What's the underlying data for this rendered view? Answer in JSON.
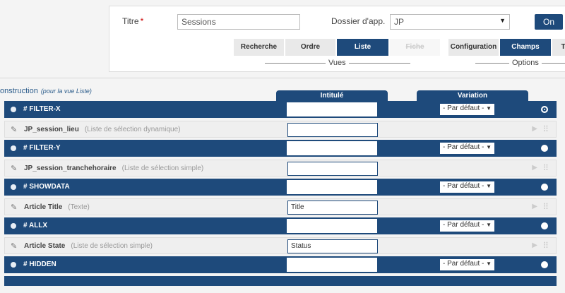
{
  "form": {
    "titre_label": "Titre",
    "required_mark": "*",
    "titre_value": "Sessions",
    "dossier_label": "Dossier d'app.",
    "dossier_value": "JP",
    "on_label": "On"
  },
  "vues": {
    "group_label": "Vues",
    "tabs": [
      "Recherche",
      "Ordre",
      "Liste",
      "Fiche"
    ]
  },
  "options": {
    "group_label": "Options",
    "tabs": [
      "Configuration",
      "Champs",
      "T"
    ]
  },
  "section": {
    "title": "onstruction",
    "subtitle": "(pour la vue Liste)"
  },
  "columns": {
    "intitule": "Intitulé",
    "variation": "Variation"
  },
  "rows": [
    {
      "kind": "header",
      "name": "# FILTER-X",
      "intitule": "",
      "variation": "- Par défaut -",
      "selected": true
    },
    {
      "kind": "field",
      "name": "JP_session_lieu",
      "type": "(Liste de sélection dynamique)",
      "intitule": ""
    },
    {
      "kind": "header",
      "name": "# FILTER-Y",
      "intitule": "",
      "variation": "- Par défaut -",
      "selected": false
    },
    {
      "kind": "field",
      "name": "JP_session_tranchehoraire",
      "type": "(Liste de sélection simple)",
      "intitule": ""
    },
    {
      "kind": "header",
      "name": "# SHOWDATA",
      "intitule": "",
      "variation": "- Par défaut -",
      "selected": false
    },
    {
      "kind": "field",
      "name": "Article Title",
      "type": "(Texte)",
      "intitule": "Title"
    },
    {
      "kind": "header",
      "name": "# ALLX",
      "intitule": "",
      "variation": "- Par défaut -",
      "selected": false
    },
    {
      "kind": "field",
      "name": "Article State",
      "type": "(Liste de sélection simple)",
      "intitule": "Status"
    },
    {
      "kind": "header",
      "name": "# HIDDEN",
      "intitule": "",
      "variation": "- Par défaut -",
      "selected": false
    }
  ],
  "colors": {
    "accent": "#1e4a7b",
    "row_light": "#efefef"
  },
  "icons": {
    "edit": "pencil-icon",
    "move": "arrow-right-icon",
    "drag": "grip-icon",
    "dropdown": "chevron-down-icon"
  }
}
